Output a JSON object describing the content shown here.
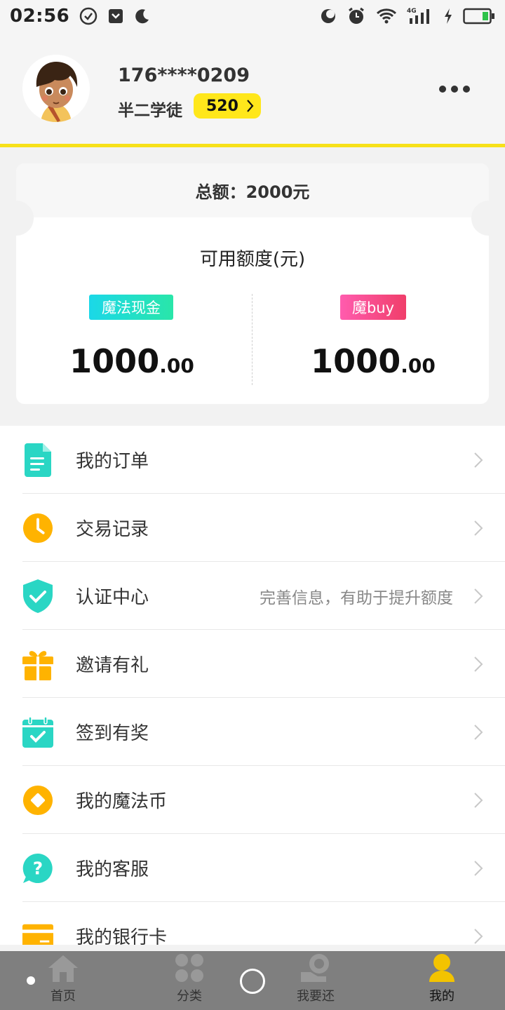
{
  "status_bar": {
    "time": "02:56",
    "network": "4G"
  },
  "profile": {
    "phone": "176****0209",
    "level_name": "半二学徒",
    "level_score": "520"
  },
  "card": {
    "total_label": "总额：2000元",
    "available_label": "可用额度(元)",
    "products": [
      {
        "tag": "魔法现金",
        "amount_int": "1000",
        "amount_dec": ".00"
      },
      {
        "tag": "魔buy",
        "amount_int": "1000",
        "amount_dec": ".00"
      }
    ]
  },
  "menu": [
    {
      "label": "我的订单",
      "icon": "document-icon",
      "color": "#2ad6c4"
    },
    {
      "label": "交易记录",
      "icon": "clock-icon",
      "color": "#ffb300"
    },
    {
      "label": "认证中心",
      "icon": "shield-check-icon",
      "color": "#2ad6c4",
      "note": "完善信息，有助于提升额度"
    },
    {
      "label": "邀请有礼",
      "icon": "gift-icon",
      "color": "#ffb300"
    },
    {
      "label": "签到有奖",
      "icon": "calendar-check-icon",
      "color": "#2ad6c4"
    },
    {
      "label": "我的魔法币",
      "icon": "coin-icon",
      "color": "#ffb300"
    },
    {
      "label": "我的客服",
      "icon": "help-chat-icon",
      "color": "#2ad6c4"
    },
    {
      "label": "我的银行卡",
      "icon": "bank-card-icon",
      "color": "#ffb300"
    }
  ],
  "bottom_nav": [
    {
      "label": "首页",
      "icon": "home-icon"
    },
    {
      "label": "分类",
      "icon": "category-icon"
    },
    {
      "label": "我要还",
      "icon": "repay-icon"
    },
    {
      "label": "我的",
      "icon": "profile-icon",
      "active": true
    }
  ],
  "colors": {
    "accent_yellow": "#f7e11a",
    "badge_yellow": "#ffe71b",
    "teal": "#2ad6c4",
    "orange": "#ffb300"
  }
}
